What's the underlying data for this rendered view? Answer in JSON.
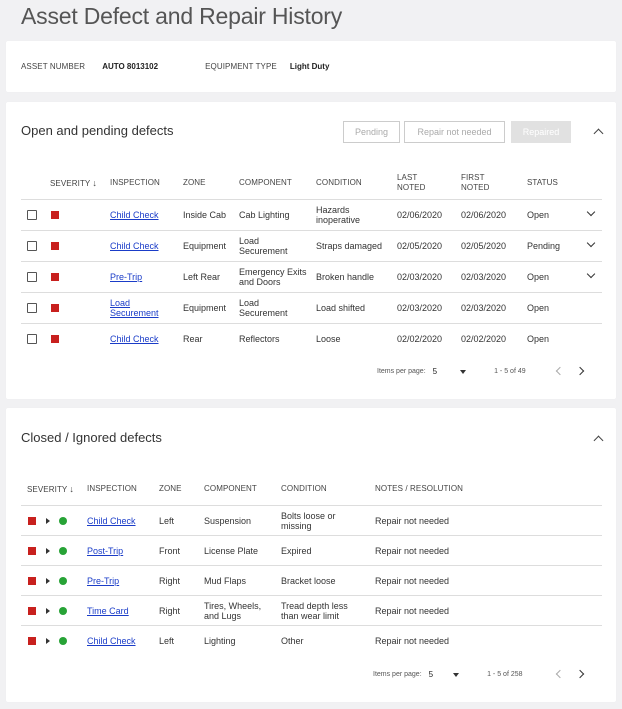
{
  "page_title": "Asset Defect and Repair History",
  "info": {
    "asset_number_label": "ASSET NUMBER",
    "asset_number_value": "AUTO 8013102",
    "equipment_type_label": "EQUIPMENT TYPE",
    "equipment_type_value": "Light Duty"
  },
  "open_section": {
    "title": "Open and pending defects",
    "filters": [
      "Pending",
      "Repair not needed",
      "Repaired"
    ],
    "active_filter": "Repaired",
    "columns": [
      "SEVERITY",
      "INSPECTION",
      "ZONE",
      "COMPONENT",
      "CONDITION",
      "LAST NOTED",
      "FIRST NOTED",
      "STATUS"
    ],
    "rows": [
      {
        "inspection": "Child Check",
        "zone": "Inside Cab",
        "component": "Cab Lighting",
        "condition": "Hazards inoperative",
        "last_noted": "02/06/2020",
        "first_noted": "02/06/2020",
        "status": "Open",
        "expandable": true
      },
      {
        "inspection": "Child Check",
        "zone": "Equipment",
        "component": "Load Securement",
        "condition": "Straps damaged",
        "last_noted": "02/05/2020",
        "first_noted": "02/05/2020",
        "status": "Pending",
        "expandable": true
      },
      {
        "inspection": "Pre-Trip",
        "zone": "Left Rear",
        "component": "Emergency Exits and Doors",
        "condition": "Broken handle",
        "last_noted": "02/03/2020",
        "first_noted": "02/03/2020",
        "status": "Open",
        "expandable": true
      },
      {
        "inspection": "Load Securement",
        "zone": "Equipment",
        "component": "Load Securement",
        "condition": "Load shifted",
        "last_noted": "02/03/2020",
        "first_noted": "02/03/2020",
        "status": "Open",
        "expandable": false
      },
      {
        "inspection": "Child Check",
        "zone": "Rear",
        "component": "Reflectors",
        "condition": "Loose",
        "last_noted": "02/02/2020",
        "first_noted": "02/02/2020",
        "status": "Open",
        "expandable": false
      }
    ],
    "pager": {
      "items_per_page_label": "Items per page:",
      "items_per_page": "5",
      "range": "1 - 5 of 49"
    }
  },
  "closed_section": {
    "title": "Closed / Ignored defects",
    "columns": [
      "SEVERITY",
      "INSPECTION",
      "ZONE",
      "COMPONENT",
      "CONDITION",
      "NOTES / RESOLUTION"
    ],
    "rows": [
      {
        "inspection": "Child Check",
        "zone": "Left",
        "component": "Suspension",
        "condition": "Bolts loose or missing",
        "notes": "Repair not needed"
      },
      {
        "inspection": "Post-Trip",
        "zone": "Front",
        "component": "License Plate",
        "condition": "Expired",
        "notes": "Repair not needed"
      },
      {
        "inspection": "Pre-Trip",
        "zone": "Right",
        "component": "Mud Flaps",
        "condition": "Bracket loose",
        "notes": "Repair not needed"
      },
      {
        "inspection": "Time Card",
        "zone": "Right",
        "component": "Tires, Wheels, and Lugs",
        "condition": "Tread depth less than wear limit",
        "notes": "Repair not needed"
      },
      {
        "inspection": "Child Check",
        "zone": "Left",
        "component": "Lighting",
        "condition": "Other",
        "notes": "Repair not needed"
      }
    ],
    "pager": {
      "items_per_page_label": "Items per page:",
      "items_per_page": "5",
      "range": "1 - 5 of 258"
    }
  },
  "colors": {
    "severity": "#c8201e",
    "resolved": "#27a336",
    "link": "#1a3cc8"
  }
}
